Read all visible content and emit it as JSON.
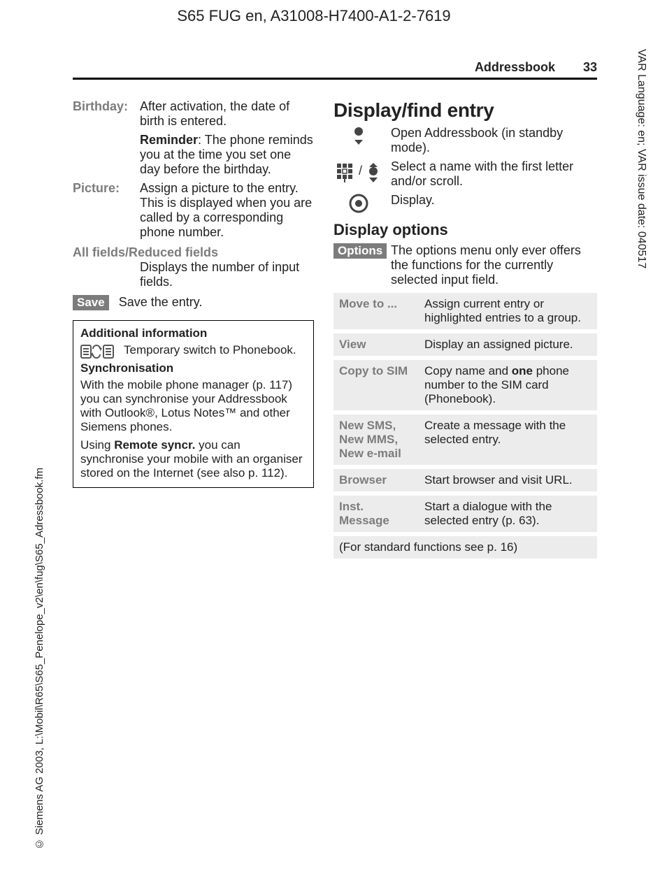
{
  "doc_header": "S65 FUG en, A31008-H7400-A1-2-7619",
  "running": {
    "section": "Addressbook",
    "page": "33"
  },
  "left": {
    "birthday": {
      "label": "Birthday:",
      "text": "After activation, the date of birth is entered."
    },
    "reminder": {
      "label": "Reminder",
      "text": ": The phone reminds you at the time you set one day before the birthday."
    },
    "picture": {
      "label": "Picture:",
      "text": "Assign a picture to the entry. This is displayed when you are called by a corresponding phone number."
    },
    "allfields": {
      "label": "All fields/Reduced fields",
      "text": "Displays the number of input fields."
    },
    "save": {
      "key": "Save",
      "text": "Save the entry."
    },
    "box": {
      "h1": "Additional information",
      "swap": "Temporary switch to Phonebook.",
      "h2": "Synchronisation",
      "p1a": "With the mobile phone manager (p. 117) you can synchronise your Addressbook with Outlook®, Lotus Notes™ and other Siemens phones.",
      "p2a": "Using ",
      "p2b": "Remote syncr.",
      "p2c": " you can synchronise your mobile with an organiser stored on the Internet (see also p. 112)."
    }
  },
  "right": {
    "h": "Display/find entry",
    "step1": "Open Addressbook (in standby mode).",
    "step2": "Select a name with the first letter and/or scroll.",
    "step3": "Display.",
    "h2": "Display options",
    "options_key": "Options",
    "options_text": "The options menu only ever offers the functions for the currently selected input field.",
    "table": [
      {
        "k": "Move to ...",
        "v": "Assign current entry or highlighted entries to a group."
      },
      {
        "k": "View",
        "v": "Display an assigned picture."
      },
      {
        "k": "Copy to SIM",
        "v_pre": "Copy name and ",
        "v_strong": "one",
        "v_post": " phone number to the SIM card (Phonebook)."
      },
      {
        "k": "New SMS, New MMS, New e-mail",
        "v": "Create a message with the selected entry."
      },
      {
        "k": "Browser",
        "v": "Start browser and visit URL."
      },
      {
        "k": "Inst. Message",
        "v": "Start a dialogue with the selected entry (p. 63)."
      }
    ],
    "footer": "(For standard functions see p. 16)"
  },
  "margins": {
    "right": "VAR Language: en; VAR issue date: 040517",
    "copyright": "© Siemens AG 2003, L:\\Mobil\\R65\\S65_Penelope_v2\\en\\fug\\S65_Adressbook.fm"
  }
}
